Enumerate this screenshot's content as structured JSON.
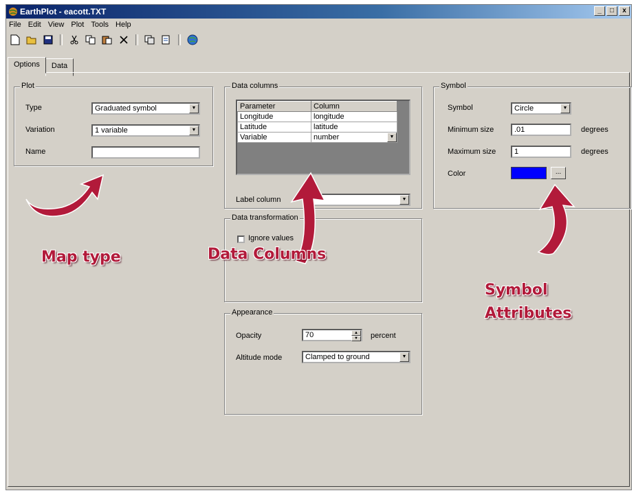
{
  "window": {
    "title": "EarthPlot - eacott.TXT"
  },
  "menu": [
    "File",
    "Edit",
    "View",
    "Plot",
    "Tools",
    "Help"
  ],
  "toolbar": {
    "icons": [
      "new-icon",
      "open-icon",
      "save-icon",
      "cut-icon",
      "copy-icon",
      "paste-icon",
      "delete-icon",
      "copy-special-icon",
      "paste-special-icon",
      "globe-icon"
    ]
  },
  "tabs": [
    {
      "label": "Options",
      "active": true
    },
    {
      "label": "Data",
      "active": false
    }
  ],
  "plot": {
    "legend": "Plot",
    "type_label": "Type",
    "type_value": "Graduated symbol",
    "variation_label": "Variation",
    "variation_value": "1 variable",
    "name_label": "Name",
    "name_value": ""
  },
  "data_columns": {
    "legend": "Data columns",
    "headers": [
      "Parameter",
      "Column"
    ],
    "rows": [
      {
        "param": "Longitude",
        "col": "longitude"
      },
      {
        "param": "Latitude",
        "col": "latitude"
      },
      {
        "param": "Variable",
        "col": "number"
      }
    ],
    "label_column_label": "Label column",
    "label_column_value": ""
  },
  "data_transformation": {
    "legend": "Data transformation",
    "ignore_values_label": "Ignore values",
    "ignore_values_checked": false
  },
  "appearance": {
    "legend": "Appearance",
    "opacity_label": "Opacity",
    "opacity_value": "70",
    "opacity_unit": "percent",
    "altitude_label": "Altitude mode",
    "altitude_value": "Clamped to ground"
  },
  "symbol": {
    "legend": "Symbol",
    "symbol_label": "Symbol",
    "symbol_value": "Circle",
    "min_label": "Minimum size",
    "min_value": ".01",
    "min_unit": "degrees",
    "max_label": "Maximum size",
    "max_value": "1",
    "max_unit": "degrees",
    "color_label": "Color",
    "color_value": "#0000ff",
    "color_button": "..."
  },
  "annotations": {
    "map_type": "Map type",
    "data_columns": "Data Columns",
    "symbol_line1": "Symbol",
    "symbol_line2": "Attributes",
    "color": "#b21a3a"
  }
}
